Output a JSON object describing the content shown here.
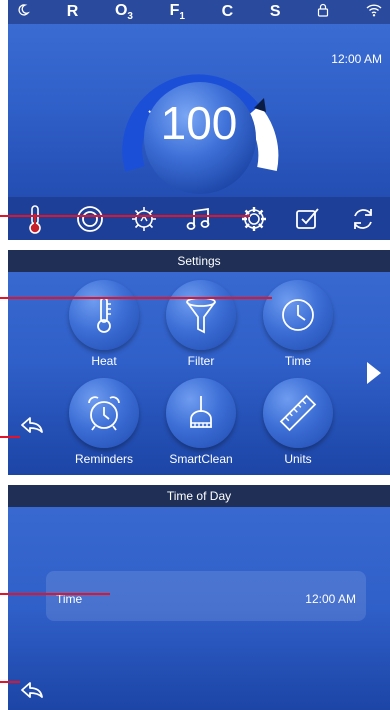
{
  "colors": {
    "accent": "#e0142b",
    "panel": "#2f5fc8",
    "bar": "#1e3f98",
    "title_bar": "#1f2f55"
  },
  "status_bar": {
    "items": [
      "R",
      "O",
      "3",
      "F",
      "1",
      "C",
      "S"
    ],
    "icons": [
      "moon-icon",
      "lock-icon",
      "wifi-icon"
    ]
  },
  "home": {
    "time": "12:00 AM",
    "set_temperature": "100",
    "icons": [
      "thermometer-icon",
      "pump-icon",
      "light-icon",
      "music-icon",
      "gear-icon",
      "checkbox-icon",
      "refresh-icon"
    ]
  },
  "settings": {
    "title": "Settings",
    "tiles": [
      {
        "label": "Heat",
        "icon": "thermometer-icon"
      },
      {
        "label": "Filter",
        "icon": "filter-icon"
      },
      {
        "label": "Time",
        "icon": "clock-icon"
      },
      {
        "label": "Reminders",
        "icon": "alarm-clock-icon"
      },
      {
        "label": "SmartClean",
        "icon": "broom-icon"
      },
      {
        "label": "Units",
        "icon": "ruler-icon"
      }
    ]
  },
  "time_of_day": {
    "title": "Time of Day",
    "label": "Time",
    "value": "12:00 AM"
  }
}
